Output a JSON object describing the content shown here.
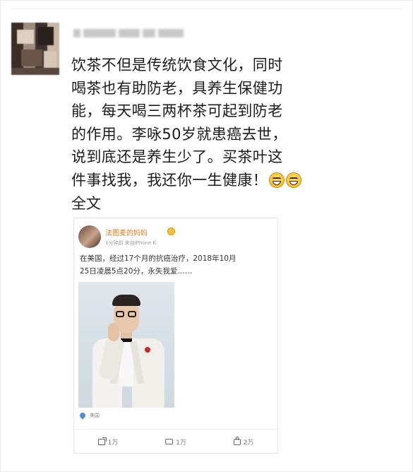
{
  "post": {
    "lines": [
      "饮茶不但是传统饮食文化，同时",
      "喝茶也有助防老，具养生保健功",
      "能，每天喝三两杯茶可起到防老",
      "的作用。李咏50岁就患癌去世，",
      "说到底还是养生少了。买茶叶这",
      "件事找我，我还你一生健康！"
    ],
    "emoji_icons": [
      "grin-emoji-icon",
      "grin-emoji-icon"
    ],
    "full_text_label": "全文"
  },
  "embedded": {
    "user_name": "法图麦的妈妈",
    "meta": "1分钟前  来自iPhone 6",
    "text_lines": [
      "在美国，经过17个月的抗癌治疗，2018年10月",
      "25日凌晨5点20分，永失我爱……"
    ],
    "location": "美国",
    "actions": [
      {
        "icon": "repost-icon",
        "count": "1万"
      },
      {
        "icon": "comment-icon",
        "count": "1万"
      },
      {
        "icon": "like-icon",
        "count": "2万"
      }
    ]
  },
  "colors": {
    "username_orange": "#e07a1e",
    "location_pin": "#4a90d9",
    "badge_gold": "#f4c33a"
  }
}
